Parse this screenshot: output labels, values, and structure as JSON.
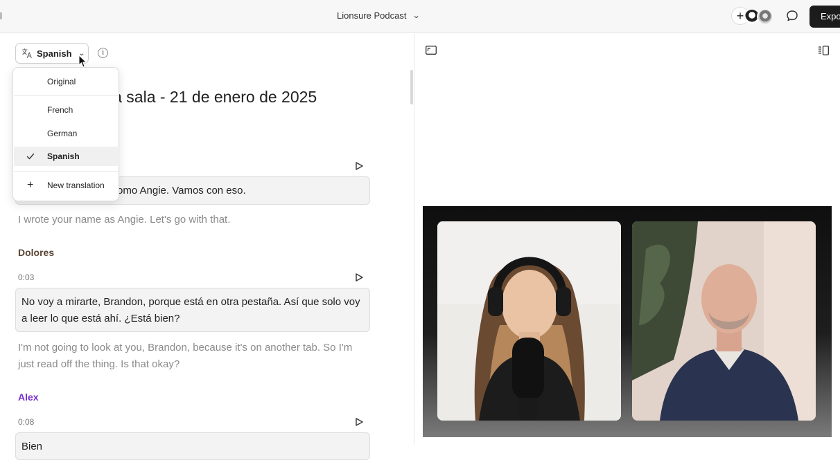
{
  "header": {
    "project_title": "Lionsure Podcast",
    "export_label": "Expo"
  },
  "toolbar": {
    "language_label": "Spanish"
  },
  "language_menu": {
    "items": [
      {
        "label": "Original",
        "selected": false
      },
      {
        "label": "French",
        "selected": false
      },
      {
        "label": "German",
        "selected": false
      },
      {
        "label": "Spanish",
        "selected": true
      }
    ],
    "new_translation_label": "New translation"
  },
  "document": {
    "title": "la sala - 21 de enero de 2025"
  },
  "transcript": [
    {
      "speaker": "",
      "time": "",
      "translated": "omo Angie. Vamos con eso.",
      "original": "I wrote your name as Angie. Let's go with that."
    },
    {
      "speaker": "Dolores",
      "speaker_color": "#5a4334",
      "time": "0:03",
      "translated": "No voy a mirarte, Brandon, porque está en otra pestaña. Así que solo voy a leer lo que está ahí. ¿Está bien?",
      "original": "I'm not going to look at you, Brandon, because it's on another tab. So I'm just read off the thing. Is that okay?"
    },
    {
      "speaker": "Alex",
      "speaker_color": "#7a2fd0",
      "time": "0:08",
      "translated": "Bien"
    }
  ],
  "colors": {
    "accent_dark": "#1c1c1c",
    "speaker_dolores": "#5a4334",
    "speaker_alex": "#7a2fd0"
  }
}
